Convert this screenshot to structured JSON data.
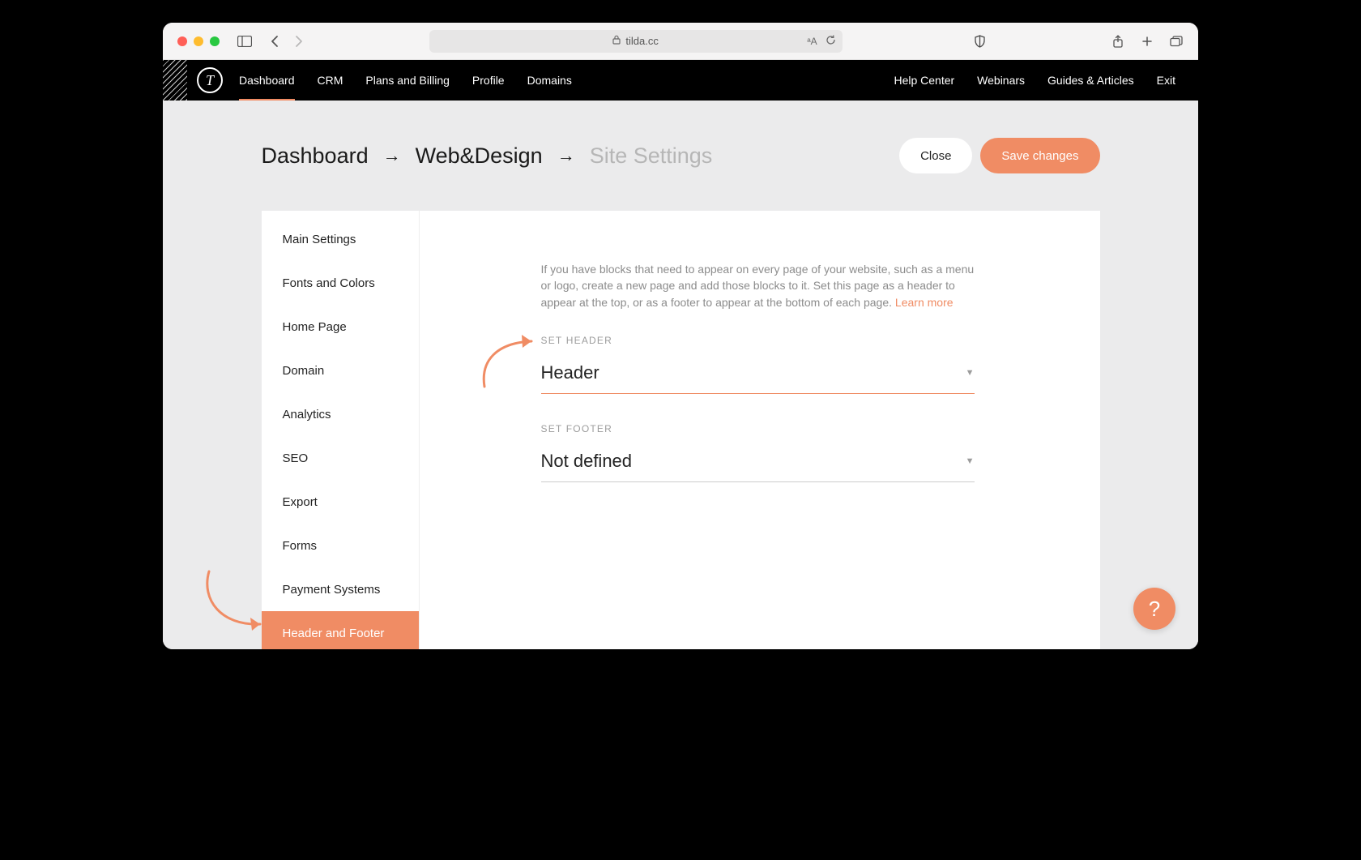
{
  "browser": {
    "url_host": "tilda.cc"
  },
  "nav": {
    "items": [
      "Dashboard",
      "CRM",
      "Plans and Billing",
      "Profile",
      "Domains"
    ],
    "right_items": [
      "Help Center",
      "Webinars",
      "Guides & Articles",
      "Exit"
    ]
  },
  "breadcrumb": {
    "parts": [
      "Dashboard",
      "Web&Design",
      "Site Settings"
    ]
  },
  "actions": {
    "close": "Close",
    "save": "Save changes"
  },
  "side_menu": {
    "items": [
      "Main Settings",
      "Fonts and Colors",
      "Home Page",
      "Domain",
      "Analytics",
      "SEO",
      "Export",
      "Forms",
      "Payment Systems",
      "Header and Footer"
    ],
    "active_index": 9
  },
  "content": {
    "help_text": "If you have blocks that need to appear on every page of your website, such as a menu or logo, create a new page and add those blocks to it. Set this page as a header to appear at the top, or as a footer to appear at the bottom of each page.",
    "learn_more": "Learn more",
    "header_group": {
      "label": "SET HEADER",
      "value": "Header"
    },
    "footer_group": {
      "label": "SET FOOTER",
      "value": "Not defined"
    }
  },
  "fab": {
    "label": "?"
  }
}
